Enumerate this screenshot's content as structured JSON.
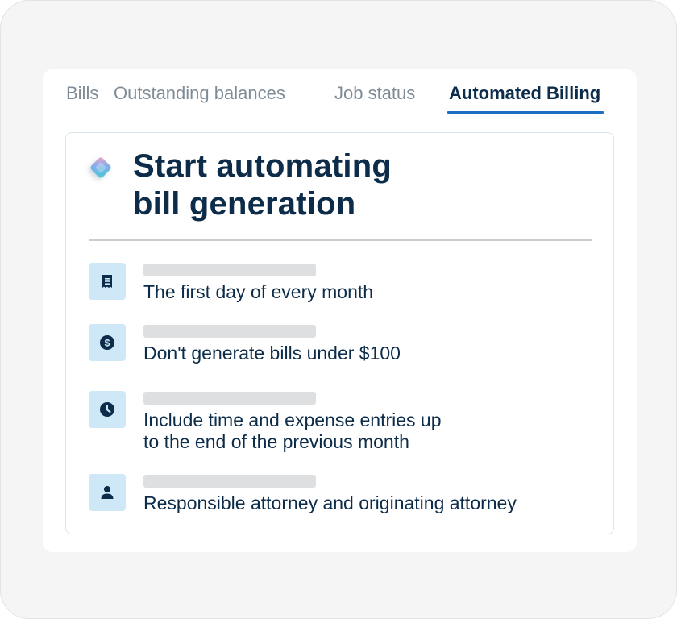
{
  "tabs": [
    {
      "label": "Bills"
    },
    {
      "label": "Outstanding balances"
    },
    {
      "label": "Job status"
    },
    {
      "label": "Automated Billing"
    }
  ],
  "card": {
    "title_line1": "Start automating",
    "title_line2": "bill generation"
  },
  "settings": [
    {
      "icon": "receipt-icon",
      "text": "The first day of every month"
    },
    {
      "icon": "dollar-icon",
      "text": "Don't generate bills under $100"
    },
    {
      "icon": "clock-icon",
      "text_line1": "Include time and expense entries up",
      "text_line2": "to the end of the previous month"
    },
    {
      "icon": "person-icon",
      "text": "Responsible attorney and originating attorney"
    }
  ],
  "colors": {
    "accent": "#1c6fc0",
    "heading": "#0c2c4a",
    "icon_bg": "#cfe8f7",
    "icon_fg": "#0c2c4a",
    "skeleton": "#dedfe0"
  }
}
